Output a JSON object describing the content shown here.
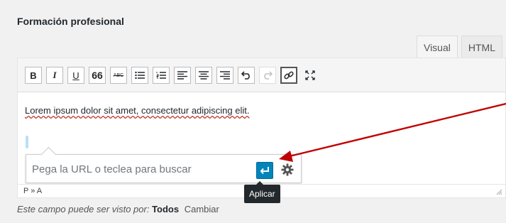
{
  "section": {
    "title": "Formación profesional"
  },
  "tabs": {
    "visual": "Visual",
    "html": "HTML"
  },
  "toolbar": {
    "bold": "B",
    "italic": "I",
    "underline": "U",
    "blockquote": "66",
    "strikethrough": "ABC"
  },
  "editor": {
    "content": "Lorem ipsum dolor sit amet, consectetur adipiscing elit.",
    "path": "P » A"
  },
  "link_popover": {
    "placeholder": "Pega la URL o teclea para buscar"
  },
  "tooltip": {
    "apply": "Aplicar"
  },
  "footer": {
    "prefix": "Este campo puede ser visto por:",
    "audience": "Todos",
    "change": "Cambiar"
  },
  "colors": {
    "accent": "#0085ba",
    "annotation_arrow": "#c00000"
  }
}
